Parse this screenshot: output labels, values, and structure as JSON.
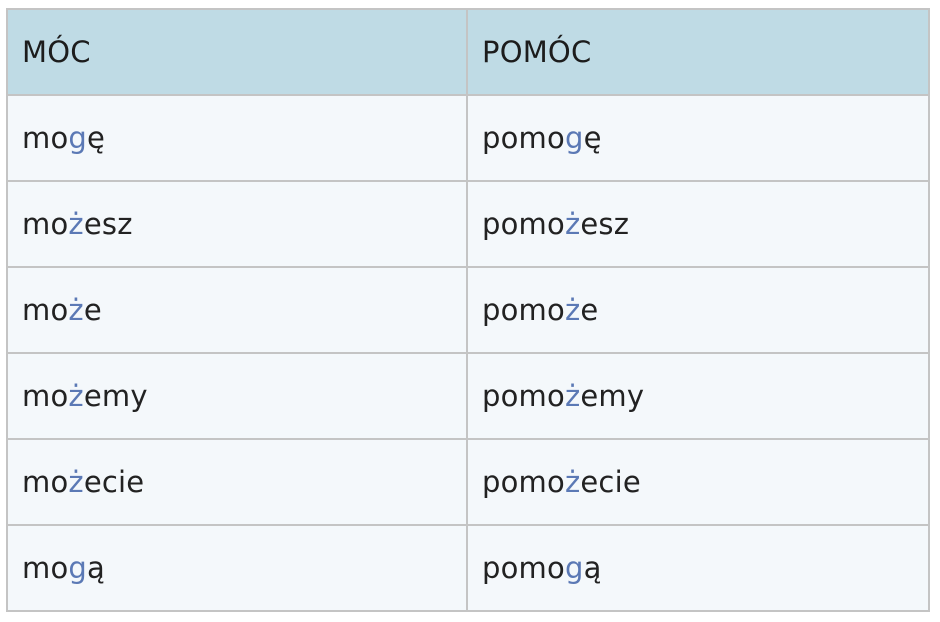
{
  "colors": {
    "header_bg": "#bfdbe5",
    "cell_bg": "#f4f8fb",
    "highlight": "#5b79b5",
    "border": "#c4c4c4"
  },
  "table": {
    "headers": [
      "MÓC",
      "POMÓC"
    ],
    "rows": [
      {
        "col1": {
          "pre": "mo",
          "hl": "g",
          "post": "ę"
        },
        "col2": {
          "pre": "pomo",
          "hl": "g",
          "post": "ę"
        }
      },
      {
        "col1": {
          "pre": "mo",
          "hl": "ż",
          "post": "esz"
        },
        "col2": {
          "pre": "pomo",
          "hl": "ż",
          "post": "esz"
        }
      },
      {
        "col1": {
          "pre": "mo",
          "hl": "ż",
          "post": "e"
        },
        "col2": {
          "pre": "pomo",
          "hl": "ż",
          "post": "e"
        }
      },
      {
        "col1": {
          "pre": "mo",
          "hl": "ż",
          "post": "emy"
        },
        "col2": {
          "pre": "pomo",
          "hl": "ż",
          "post": "emy"
        }
      },
      {
        "col1": {
          "pre": "mo",
          "hl": "ż",
          "post": "ecie"
        },
        "col2": {
          "pre": "pomo",
          "hl": "ż",
          "post": "ecie"
        }
      },
      {
        "col1": {
          "pre": "mo",
          "hl": "g",
          "post": "ą"
        },
        "col2": {
          "pre": "pomo",
          "hl": "g",
          "post": "ą"
        }
      }
    ]
  }
}
